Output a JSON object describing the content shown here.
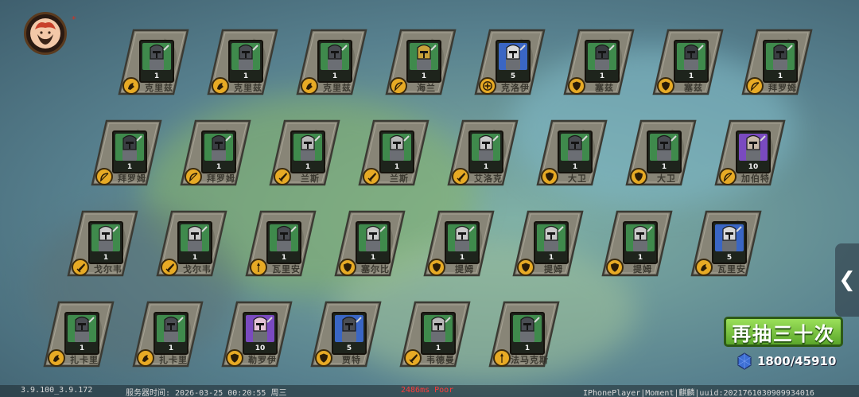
{
  "colors": {
    "role_badge": "#e7aa25",
    "button_green": "#6fbf35",
    "ping_red": "#ff3b3b",
    "rarity": {
      "green": "#3f8a4c",
      "gold": "#d7b33a",
      "blue": "#3a66c4",
      "purple": "#7a4ac0"
    }
  },
  "rows": [
    {
      "cards": [
        {
          "name": "克里兹",
          "level": "1",
          "rarity": "green",
          "role": "melee-icon",
          "helm": "#4a4d53"
        },
        {
          "name": "克里兹",
          "level": "1",
          "rarity": "green",
          "role": "melee-icon",
          "helm": "#4a4d53"
        },
        {
          "name": "克里兹",
          "level": "1",
          "rarity": "green",
          "role": "melee-icon",
          "helm": "#4a4d53"
        },
        {
          "name": "海兰",
          "level": "1",
          "rarity": "green",
          "role": "bow-icon",
          "helm": "#c9a23a"
        },
        {
          "name": "克洛伊",
          "level": "5",
          "rarity": "blue",
          "role": "healer-icon",
          "helm": "#d8d8d8"
        },
        {
          "name": "塞兹",
          "level": "1",
          "rarity": "green",
          "role": "shield-icon",
          "helm": "#3a3d42"
        },
        {
          "name": "塞兹",
          "level": "1",
          "rarity": "green",
          "role": "shield-icon",
          "helm": "#3a3d42"
        },
        {
          "name": "拜罗姆",
          "level": "1",
          "rarity": "green",
          "role": "bow-icon",
          "helm": "#3a3d42"
        }
      ]
    },
    {
      "cards": [
        {
          "name": "拜罗姆",
          "level": "1",
          "rarity": "green",
          "role": "bow-icon",
          "helm": "#3a3d42"
        },
        {
          "name": "拜罗姆",
          "level": "1",
          "rarity": "green",
          "role": "bow-icon",
          "helm": "#3a3d42"
        },
        {
          "name": "兰斯",
          "level": "1",
          "rarity": "green",
          "role": "sword-icon",
          "helm": "#b8b8b8"
        },
        {
          "name": "兰斯",
          "level": "1",
          "rarity": "green",
          "role": "sword-icon",
          "helm": "#b8b8b8"
        },
        {
          "name": "艾洛克",
          "level": "1",
          "rarity": "green",
          "role": "sword-icon",
          "helm": "#c8c8c8"
        },
        {
          "name": "大卫",
          "level": "1",
          "rarity": "green",
          "role": "shield-icon",
          "helm": "#4a4d53"
        },
        {
          "name": "大卫",
          "level": "1",
          "rarity": "green",
          "role": "shield-icon",
          "helm": "#4a4d53"
        },
        {
          "name": "加伯特",
          "level": "10",
          "rarity": "purple",
          "role": "bow-icon",
          "helm": "#c7b8a8"
        }
      ]
    },
    {
      "cards": [
        {
          "name": "戈尔韦",
          "level": "1",
          "rarity": "green",
          "role": "sword-icon",
          "helm": "#c8c8c8"
        },
        {
          "name": "戈尔韦",
          "level": "1",
          "rarity": "green",
          "role": "sword-icon",
          "helm": "#c8c8c8"
        },
        {
          "name": "瓦里安",
          "level": "1",
          "rarity": "green",
          "role": "spear-icon",
          "helm": "#4a4d53"
        },
        {
          "name": "塞尔比",
          "level": "1",
          "rarity": "green",
          "role": "shield-icon",
          "helm": "#c8c8c8"
        },
        {
          "name": "提姆",
          "level": "1",
          "rarity": "green",
          "role": "shield-icon",
          "helm": "#c8c8c8"
        },
        {
          "name": "提姆",
          "level": "1",
          "rarity": "green",
          "role": "shield-icon",
          "helm": "#c8c8c8"
        },
        {
          "name": "提姆",
          "level": "1",
          "rarity": "green",
          "role": "shield-icon",
          "helm": "#c8c8c8"
        },
        {
          "name": "瓦里安",
          "level": "5",
          "rarity": "blue",
          "role": "melee-icon",
          "helm": "#d8d8d8"
        }
      ]
    },
    {
      "cards": [
        {
          "name": "扎卡里",
          "level": "1",
          "rarity": "green",
          "role": "melee-icon",
          "helm": "#4a4d53"
        },
        {
          "name": "扎卡里",
          "level": "1",
          "rarity": "green",
          "role": "melee-icon",
          "helm": "#4a4d53"
        },
        {
          "name": "勒罗伊",
          "level": "10",
          "rarity": "purple",
          "role": "shield-icon",
          "helm": "#e6c4d8"
        },
        {
          "name": "贾特",
          "level": "5",
          "rarity": "blue",
          "role": "shield-icon",
          "helm": "#4a4d53"
        },
        {
          "name": "韦德曼",
          "level": "1",
          "rarity": "green",
          "role": "sword-icon",
          "helm": "#b8b8b8"
        },
        {
          "name": "法马克斯",
          "level": "1",
          "rarity": "green",
          "role": "spear-icon",
          "helm": "#4a4d53"
        }
      ]
    }
  ],
  "draw_again_label": "再抽三十次",
  "gems": "1800/45910",
  "gem_icon": "gem-icon",
  "side_tab_icon": "chevron-left-icon",
  "side_tab_glyph": "❮",
  "avatar_dot": "*",
  "footer": {
    "version": "3.9.100_3.9.172",
    "server_time": "服务器时间:  2026-03-25  00:20:55  周三",
    "ping": "2486ms Poor",
    "device": "IPhonePlayer|Moment|麒麟|uuid:2021761030909934016"
  }
}
